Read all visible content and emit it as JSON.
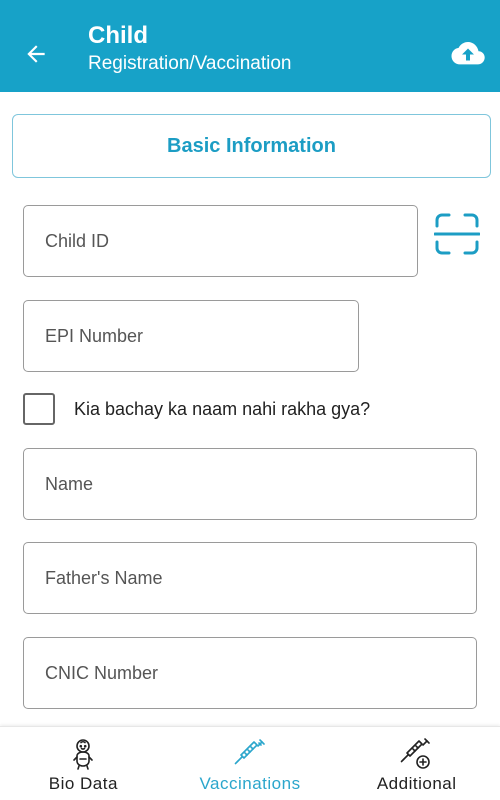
{
  "header": {
    "title": "Child",
    "subtitle": "Registration/Vaccination",
    "back_icon": "arrow-left-icon",
    "upload_icon": "cloud-upload-icon",
    "color": "#17a2c8"
  },
  "section": {
    "title": "Basic Information",
    "accent": "#1c9dc4"
  },
  "form": {
    "child_id_placeholder": "Child ID",
    "scan_icon": "qr-scan-icon",
    "epi_placeholder": "EPI Number",
    "no_name_checkbox_label": "Kia bachay ka naam nahi rakha gya?",
    "name_placeholder": "Name",
    "father_name_placeholder": "Father's Name",
    "cnic_placeholder": "CNIC Number"
  },
  "bottom_nav": {
    "items": [
      {
        "label": "Bio Data",
        "icon": "baby-icon",
        "active": false
      },
      {
        "label": "Vaccinations",
        "icon": "syringe-icon",
        "active": true
      },
      {
        "label": "Additional",
        "icon": "syringe-plus-icon",
        "active": false
      }
    ],
    "active_color": "#2ba6cc"
  }
}
